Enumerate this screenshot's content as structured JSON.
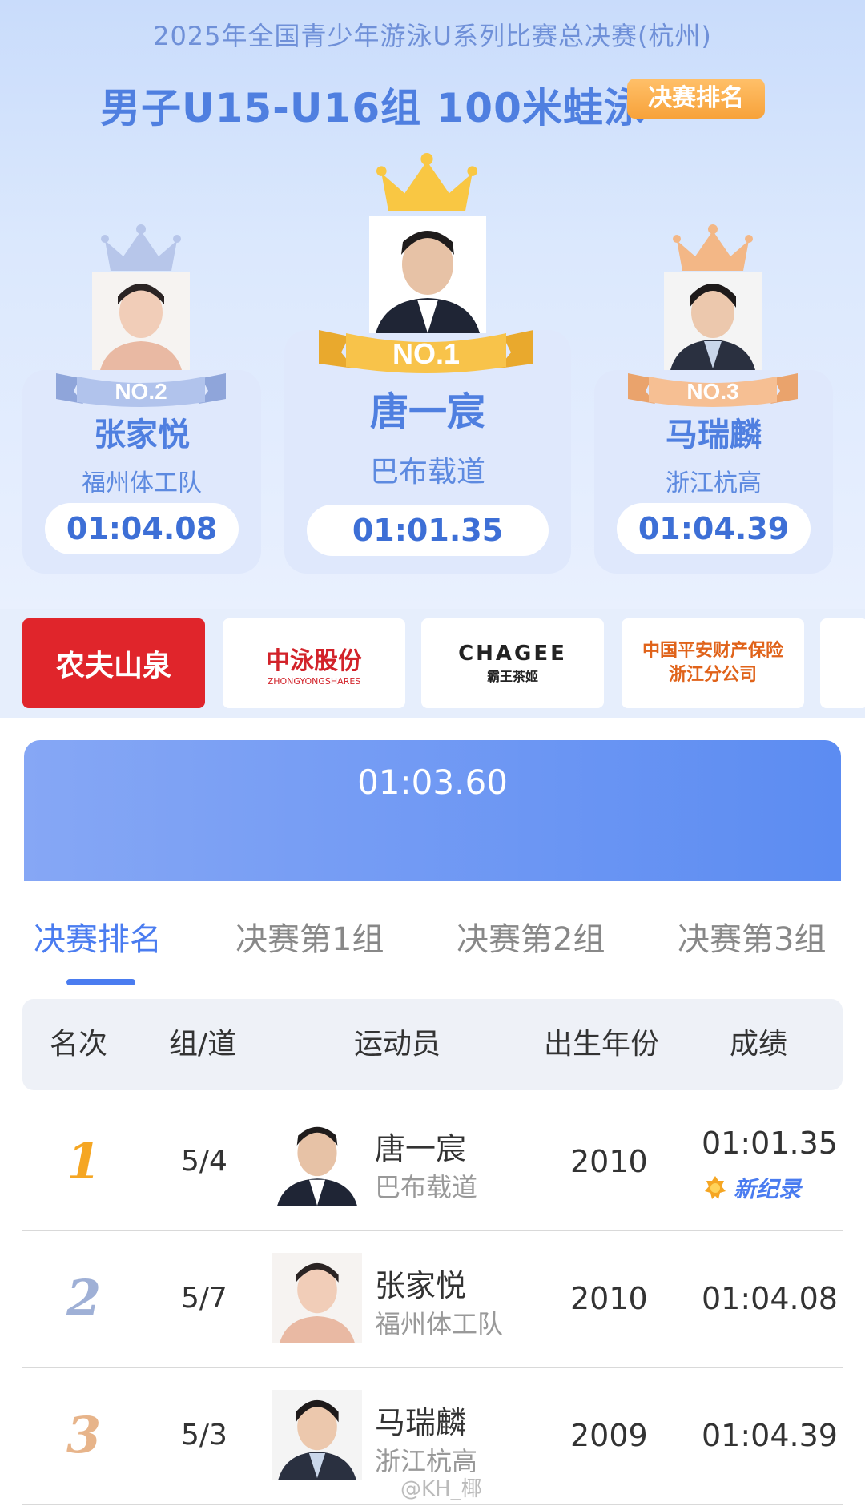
{
  "header": {
    "event_title": "2025年全国青少年游泳U系列比赛总决赛(杭州)",
    "group_title": "男子U15-U16组 100米蛙泳",
    "rank_tag": "决赛排名"
  },
  "podium": [
    {
      "rank_label": "NO.2",
      "name": "张家悦",
      "team": "福州体工队",
      "time": "01:04.08",
      "crown_color": "#b7c6ea"
    },
    {
      "rank_label": "NO.1",
      "name": "唐一宸",
      "team": "巴布载道",
      "time": "01:01.35",
      "crown_color": "#f9c743"
    },
    {
      "rank_label": "NO.3",
      "name": "马瑞麟",
      "team": "浙江杭高",
      "time": "01:04.39",
      "crown_color": "#f3b786"
    }
  ],
  "sponsors": [
    {
      "name": "农夫山泉"
    },
    {
      "name": "中泳股份",
      "sub": "ZHONGYONGSHARES"
    },
    {
      "name": "CHAGEE",
      "sub": "霸王茶姬"
    },
    {
      "name": "中国平安财产保险",
      "sub": "浙江分公司"
    }
  ],
  "banner": {
    "time": "01:03.60"
  },
  "tabs": [
    "决赛排名",
    "决赛第1组",
    "决赛第2组",
    "决赛第3组"
  ],
  "table": {
    "headers": [
      "名次",
      "组/道",
      "运动员",
      "出生年份",
      "成绩"
    ],
    "rows": [
      {
        "rank": "1",
        "group_lane": "5/4",
        "name": "唐一宸",
        "team": "巴布载道",
        "birth_year": "2010",
        "result": "01:01.35",
        "badge": "新纪录",
        "rank_color": "#f5a623"
      },
      {
        "rank": "2",
        "group_lane": "5/7",
        "name": "张家悦",
        "team": "福州体工队",
        "birth_year": "2010",
        "result": "01:04.08",
        "rank_color": "#9fb0d6"
      },
      {
        "rank": "3",
        "group_lane": "5/3",
        "name": "马瑞麟",
        "team": "浙江杭高",
        "birth_year": "2009",
        "result": "01:04.39",
        "rank_color": "#e7b48a"
      }
    ]
  },
  "watermark": "@KH_椰"
}
